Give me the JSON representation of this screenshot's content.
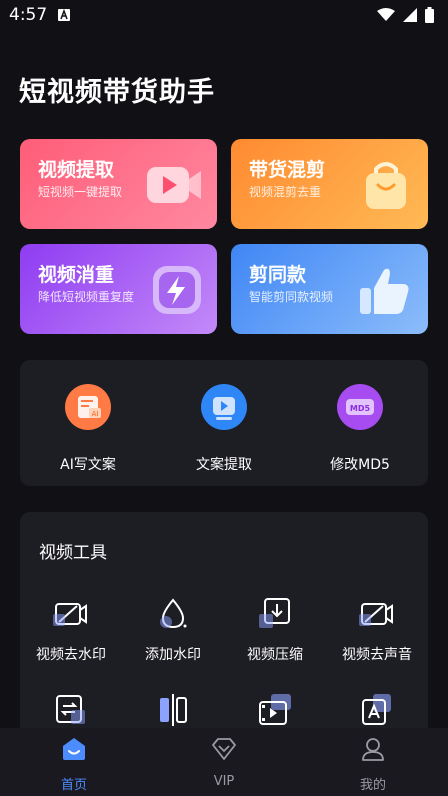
{
  "status_bar": {
    "time": "4:57"
  },
  "header": {
    "title": "短视频带货助手"
  },
  "feature_cards": [
    {
      "title": "视频提取",
      "subtitle": "短视频一键提取",
      "icon": "play-video-icon",
      "color": "#ff6b83"
    },
    {
      "title": "带货混剪",
      "subtitle": "视频混剪去重",
      "icon": "shopping-bag-icon",
      "color": "#ff9d3f"
    },
    {
      "title": "视频消重",
      "subtitle": "降低短视频重复度",
      "icon": "lightning-icon",
      "color": "#a55cf5"
    },
    {
      "title": "剪同款",
      "subtitle": "智能剪同款视频",
      "icon": "thumbs-up-icon",
      "color": "#5597f7"
    }
  ],
  "quick_tools": [
    {
      "label": "AI写文案",
      "icon": "ai-copywriting-icon",
      "color": "#ff7a45"
    },
    {
      "label": "文案提取",
      "icon": "text-extract-icon",
      "color": "#2f86f6"
    },
    {
      "label": "修改MD5",
      "icon": "md5-icon",
      "color": "#a64cf0"
    }
  ],
  "video_tools": {
    "title": "视频工具",
    "items": [
      {
        "label": "视频去水印",
        "icon": "remove-watermark-icon"
      },
      {
        "label": "添加水印",
        "icon": "add-watermark-icon"
      },
      {
        "label": "视频压缩",
        "icon": "compress-video-icon"
      },
      {
        "label": "视频去声音",
        "icon": "mute-video-icon"
      },
      {
        "label": "",
        "icon": "rotate-video-icon"
      },
      {
        "label": "",
        "icon": "split-video-icon"
      },
      {
        "label": "",
        "icon": "video-frames-icon"
      },
      {
        "label": "",
        "icon": "video-text-icon"
      }
    ]
  },
  "bottom_nav": [
    {
      "label": "首页",
      "icon": "home-icon",
      "active": true
    },
    {
      "label": "VIP",
      "icon": "vip-diamond-icon",
      "active": false
    },
    {
      "label": "我的",
      "icon": "profile-icon",
      "active": false
    }
  ],
  "colors": {
    "background": "#101015",
    "panel": "#1d1d24",
    "nav_active": "#4d8cff",
    "nav_inactive": "#9a9aa4"
  }
}
